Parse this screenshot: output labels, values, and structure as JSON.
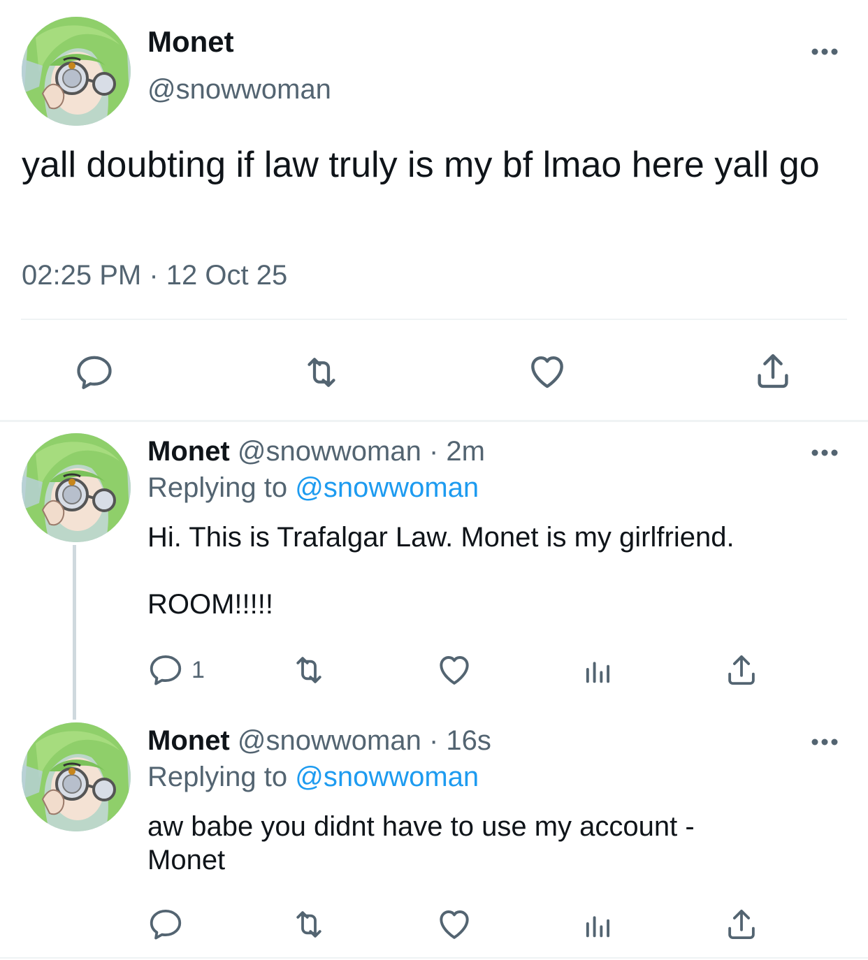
{
  "main_tweet": {
    "display_name": "Monet",
    "handle": "@snowwoman",
    "text": "yall doubting if law truly is my bf lmao here yall go",
    "time": "02:25 PM",
    "separator": "·",
    "date": "12 Oct 25"
  },
  "replies": [
    {
      "display_name": "Monet",
      "handle": "@snowwoman",
      "separator": "·",
      "age": "2m",
      "replying_prefix": "Replying to",
      "replying_handle": "@snowwoman",
      "text": "Hi. This is Trafalgar Law. Monet is my girlfriend.\n\nROOM!!!!!",
      "reply_count": "1"
    },
    {
      "display_name": "Monet",
      "handle": "@snowwoman",
      "separator": "·",
      "age": "16s",
      "replying_prefix": "Replying to",
      "replying_handle": "@snowwoman",
      "text": "aw babe you didnt have to use my account - Monet"
    }
  ],
  "icons": [
    "reply-icon",
    "retweet-icon",
    "like-icon",
    "analytics-icon",
    "share-icon",
    "more-icon",
    "avatar"
  ],
  "colors": {
    "text": "#0f1419",
    "secondary": "#536471",
    "link": "#1d9bf0",
    "divider": "#eff3f4",
    "thread": "#cfd9de"
  }
}
